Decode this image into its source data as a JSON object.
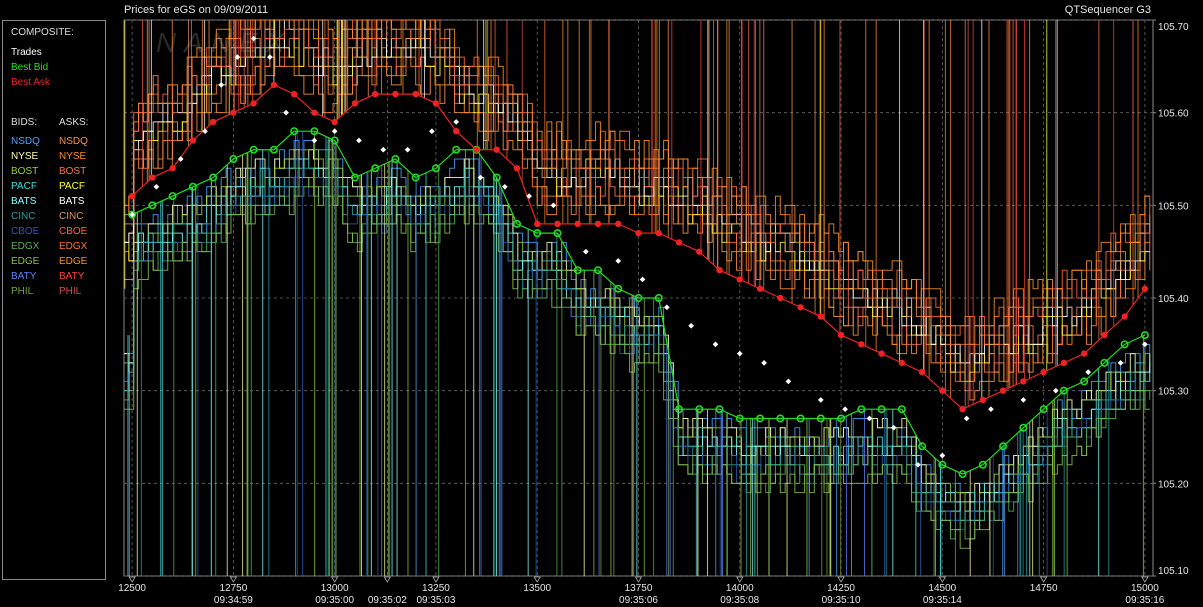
{
  "header": {
    "title": "Prices for  eGS  on  09/09/2011",
    "app": "QTSequencer G3",
    "watermark": "NANEX"
  },
  "legend": {
    "composite_label": "COMPOSITE:",
    "composite": [
      {
        "label": "Trades",
        "color": "#ffffff"
      },
      {
        "label": "Best Bid",
        "color": "#22dd22"
      },
      {
        "label": "Best Ask",
        "color": "#ee2222"
      }
    ],
    "bids_label": "BIDS:",
    "asks_label": "ASKS:",
    "bids": [
      {
        "label": "NSDQ",
        "color": "#4aa0ff"
      },
      {
        "label": "NYSE",
        "color": "#ffffaa"
      },
      {
        "label": "BOST",
        "color": "#9acd32"
      },
      {
        "label": "PACF",
        "color": "#44dddd"
      },
      {
        "label": "BATS",
        "color": "#88ffff"
      },
      {
        "label": "CINC",
        "color": "#22a0a0"
      },
      {
        "label": "CBOE",
        "color": "#2a5aaa"
      },
      {
        "label": "EDGX",
        "color": "#55b055"
      },
      {
        "label": "EDGE",
        "color": "#88c048"
      },
      {
        "label": "BATY",
        "color": "#6080ff"
      },
      {
        "label": "PHIL",
        "color": "#78a040"
      }
    ],
    "asks": [
      {
        "label": "NSDQ",
        "color": "#ff9040"
      },
      {
        "label": "NYSE",
        "color": "#ff8c20"
      },
      {
        "label": "BOST",
        "color": "#ff7050"
      },
      {
        "label": "PACF",
        "color": "#ffff30"
      },
      {
        "label": "BATS",
        "color": "#ffffff"
      },
      {
        "label": "CINC",
        "color": "#e09060"
      },
      {
        "label": "CBOE",
        "color": "#ff6040"
      },
      {
        "label": "EDGX",
        "color": "#ff7030"
      },
      {
        "label": "EDGE",
        "color": "#ff9020"
      },
      {
        "label": "BATY",
        "color": "#ff4040"
      },
      {
        "label": "PHIL",
        "color": "#d05050"
      }
    ]
  },
  "chart_data": {
    "type": "line",
    "ylim": [
      105.1,
      105.7
    ],
    "xlim": [
      12480,
      15020
    ],
    "y_ticks": [
      "105.70",
      "105.60",
      "105.50",
      "105.40",
      "105.30",
      "105.20",
      "105.10"
    ],
    "y_tick_values": [
      105.7,
      105.6,
      105.5,
      105.4,
      105.3,
      105.2,
      105.1
    ],
    "x_ticks": [
      {
        "seq": "12500",
        "time": "",
        "v": 12500
      },
      {
        "seq": "12750",
        "time": "09:34:59",
        "v": 12750
      },
      {
        "seq": "13000",
        "time": "09:35:00",
        "v": 13000
      },
      {
        "seq": "",
        "time": "09:35:02",
        "v": 13130
      },
      {
        "seq": "13250",
        "time": "09:35:03",
        "v": 13250
      },
      {
        "seq": "13500",
        "time": "",
        "v": 13500
      },
      {
        "seq": "13750",
        "time": "09:35:06",
        "v": 13750
      },
      {
        "seq": "14000",
        "time": "09:35:08",
        "v": 14000
      },
      {
        "seq": "14250",
        "time": "09:35:10",
        "v": 14250
      },
      {
        "seq": "14500",
        "time": "09:35:14",
        "v": 14500
      },
      {
        "seq": "14750",
        "time": "",
        "v": 14750
      },
      {
        "seq": "15000",
        "time": "09:35:16",
        "v": 15000
      }
    ],
    "grid": true,
    "series": [
      {
        "name": "Best Bid",
        "color": "#22dd22",
        "x": [
          12500,
          12550,
          12600,
          12650,
          12700,
          12750,
          12800,
          12850,
          12900,
          12950,
          13000,
          13050,
          13100,
          13150,
          13200,
          13250,
          13300,
          13350,
          13400,
          13450,
          13500,
          13550,
          13600,
          13650,
          13700,
          13750,
          13800,
          13850,
          13900,
          13950,
          14000,
          14050,
          14100,
          14150,
          14200,
          14250,
          14300,
          14350,
          14400,
          14450,
          14500,
          14550,
          14600,
          14650,
          14700,
          14750,
          14800,
          14850,
          14900,
          14950,
          15000
        ],
        "y": [
          105.49,
          105.5,
          105.51,
          105.52,
          105.53,
          105.55,
          105.56,
          105.56,
          105.58,
          105.58,
          105.57,
          105.53,
          105.54,
          105.55,
          105.53,
          105.54,
          105.56,
          105.56,
          105.53,
          105.48,
          105.47,
          105.47,
          105.43,
          105.43,
          105.41,
          105.4,
          105.4,
          105.28,
          105.28,
          105.28,
          105.27,
          105.27,
          105.27,
          105.27,
          105.27,
          105.27,
          105.28,
          105.28,
          105.28,
          105.24,
          105.22,
          105.21,
          105.22,
          105.24,
          105.26,
          105.28,
          105.3,
          105.31,
          105.33,
          105.35,
          105.36
        ]
      },
      {
        "name": "Best Ask",
        "color": "#ee2222",
        "x": [
          12500,
          12550,
          12600,
          12650,
          12700,
          12750,
          12800,
          12850,
          12900,
          12950,
          13000,
          13050,
          13100,
          13150,
          13200,
          13250,
          13300,
          13350,
          13400,
          13450,
          13500,
          13550,
          13600,
          13650,
          13700,
          13750,
          13800,
          13850,
          13900,
          13950,
          14000,
          14050,
          14100,
          14150,
          14200,
          14250,
          14300,
          14350,
          14400,
          14450,
          14500,
          14550,
          14600,
          14650,
          14700,
          14750,
          14800,
          14850,
          14900,
          14950,
          15000
        ],
        "y": [
          105.51,
          105.53,
          105.54,
          105.57,
          105.59,
          105.6,
          105.61,
          105.63,
          105.62,
          105.6,
          105.59,
          105.61,
          105.62,
          105.62,
          105.62,
          105.61,
          105.58,
          105.56,
          105.56,
          105.54,
          105.48,
          105.48,
          105.48,
          105.48,
          105.48,
          105.47,
          105.47,
          105.46,
          105.45,
          105.43,
          105.42,
          105.41,
          105.4,
          105.39,
          105.38,
          105.36,
          105.35,
          105.34,
          105.33,
          105.32,
          105.3,
          105.28,
          105.29,
          105.3,
          105.31,
          105.32,
          105.33,
          105.34,
          105.36,
          105.38,
          105.41
        ]
      },
      {
        "name": "Trades",
        "color": "#ffffff",
        "x": [
          12500,
          12560,
          12620,
          12680,
          12720,
          12760,
          12800,
          12840,
          12880,
          12950,
          13000,
          13060,
          13120,
          13180,
          13240,
          13300,
          13360,
          13420,
          13480,
          13540,
          13620,
          13700,
          13760,
          13820,
          13880,
          13940,
          14000,
          14060,
          14120,
          14200,
          14260,
          14320,
          14380,
          14440,
          14500,
          14560,
          14620,
          14700,
          14780,
          14860,
          14940,
          15000
        ],
        "y": [
          105.49,
          105.52,
          105.55,
          105.58,
          105.63,
          105.66,
          105.68,
          105.66,
          105.6,
          105.57,
          105.58,
          105.57,
          105.56,
          105.56,
          105.58,
          105.59,
          105.53,
          105.52,
          105.51,
          105.5,
          105.45,
          105.44,
          105.42,
          105.39,
          105.37,
          105.35,
          105.34,
          105.33,
          105.31,
          105.29,
          105.28,
          105.27,
          105.26,
          105.22,
          105.23,
          105.27,
          105.28,
          105.29,
          105.3,
          105.32,
          105.33,
          105.35
        ]
      }
    ]
  }
}
